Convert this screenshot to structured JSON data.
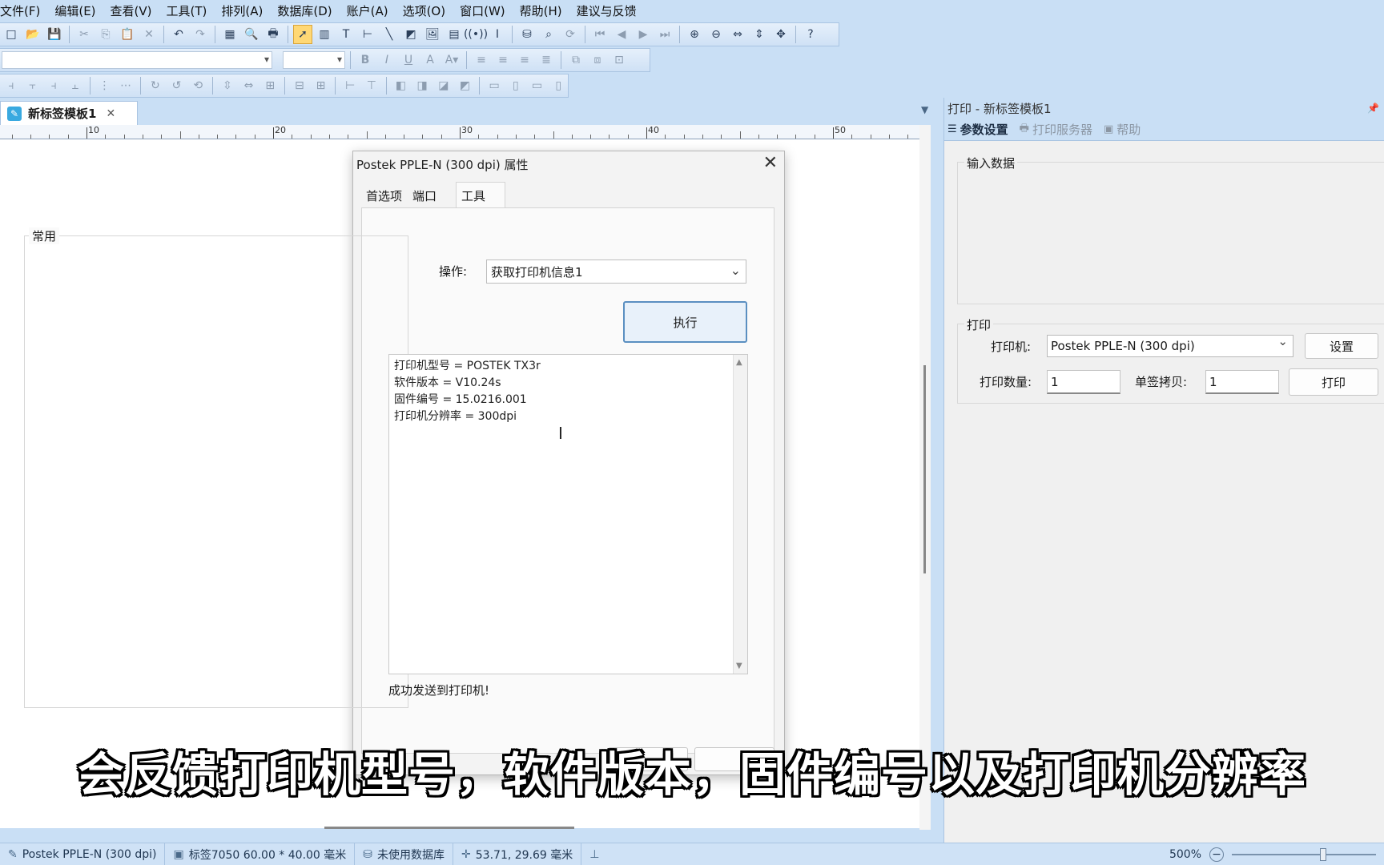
{
  "menubar": [
    "文件(F)",
    "编辑(E)",
    "查看(V)",
    "工具(T)",
    "排列(A)",
    "数据库(D)",
    "账户(A)",
    "选项(O)",
    "窗口(W)",
    "帮助(H)",
    "建议与反馈"
  ],
  "document_tab": {
    "title": "新标签模板1",
    "close": "✕"
  },
  "ruler": {
    "labels": [
      "10",
      "20",
      "30",
      "40",
      "50"
    ]
  },
  "dialog": {
    "title": "Postek PPLE-N (300 dpi) 属性",
    "close": "✕",
    "tabs": [
      "首选项",
      "端口",
      "工具"
    ],
    "group_label": "常用",
    "operation_label": "操作:",
    "operation_value": "获取打印机信息1",
    "execute_label": "执行",
    "output_lines": [
      "打印机型号 = POSTEK TX3r",
      "软件版本 = V10.24s",
      "固件编号 = 15.0216.001",
      "打印机分辨率 = 300dpi"
    ],
    "status_message": "成功发送到打印机!"
  },
  "right_panel": {
    "title": "打印 - 新标签模板1",
    "pin": "ᵖ",
    "tabs": {
      "params": "参数设置",
      "server": "打印服务器",
      "help": "帮助"
    },
    "input_group_label": "输入数据",
    "print_group_label": "打印",
    "printer_label": "打印机:",
    "printer_value": "Postek PPLE-N (300 dpi)",
    "settings_button": "设置",
    "quantity_label": "打印数量:",
    "quantity_value": "1",
    "copies_label": "单签拷贝:",
    "copies_value": "1",
    "print_button": "打印"
  },
  "subtitle": "会反馈打印机型号，软件版本，固件编号以及打印机分辨率",
  "statusbar": {
    "printer": "Postek PPLE-N (300 dpi)",
    "label_info": "标签7050  60.00 * 40.00 毫米",
    "database": "未使用数据库",
    "coords": "53.71,  29.69 毫米",
    "zoom": "500%"
  },
  "colors": {
    "accent": "#5a8fc1",
    "chrome": "#c9dff5",
    "tab_icon": "#39a9e0"
  }
}
